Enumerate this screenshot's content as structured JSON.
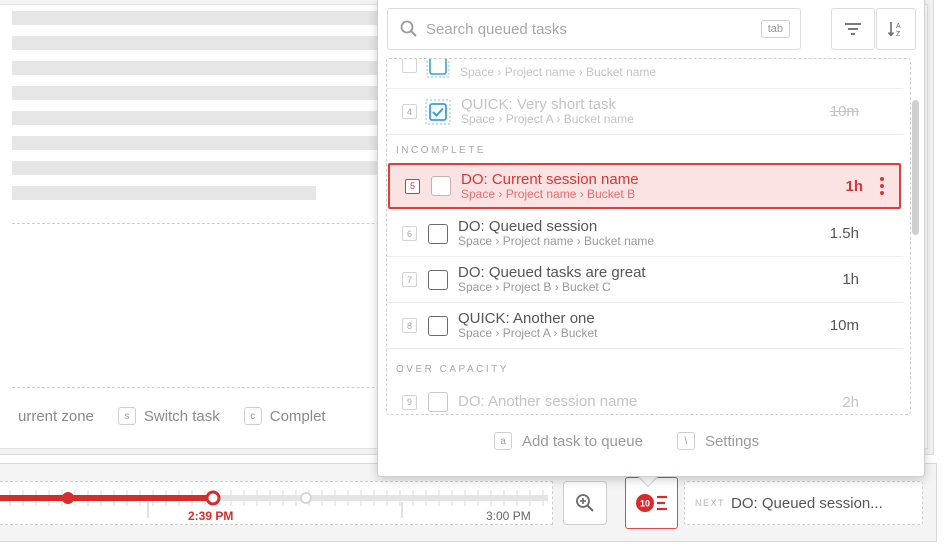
{
  "popup": {
    "search_placeholder": "Search queued tasks",
    "search_key": "tab",
    "sections": {
      "incomplete": "INCOMPLETE",
      "over_capacity": "OVER CAPACITY"
    },
    "tasks": [
      {
        "num": "",
        "title": "",
        "sub": "Space › Project name › Bucket name",
        "dur": "???",
        "state": "faded-checked"
      },
      {
        "num": "4",
        "title": "QUICK: Very short task",
        "sub": "Space › Project A › Bucket name",
        "dur": "10m",
        "state": "faded-checked"
      },
      {
        "num": "5",
        "title": "DO: Current session name",
        "sub": "Space › Project name › Bucket B",
        "dur": "1h",
        "state": "current"
      },
      {
        "num": "6",
        "title": "DO: Queued session",
        "sub": "Space › Project name › Bucket name",
        "dur": "1.5h",
        "state": "normal"
      },
      {
        "num": "7",
        "title": "DO: Queued tasks are great",
        "sub": "Space › Project B › Bucket C",
        "dur": "1h",
        "state": "normal"
      },
      {
        "num": "8",
        "title": "QUICK: Another one",
        "sub": "Space › Project A › Bucket",
        "dur": "10m",
        "state": "normal"
      },
      {
        "num": "9",
        "title": "DO: Another session name",
        "sub": "",
        "dur": "2h",
        "state": "faded"
      }
    ],
    "footer": {
      "add_key": "a",
      "add_label": "Add task to queue",
      "settings_key": "\\",
      "settings_label": "Settings"
    }
  },
  "shortcuts": [
    {
      "key": "",
      "label": "urrent zone"
    },
    {
      "key": "s",
      "label": "Switch task"
    },
    {
      "key": "c",
      "label": "Complet"
    }
  ],
  "timeline": {
    "current_time": "2:39 PM",
    "end_time": "3:00 PM",
    "progress": 0.38
  },
  "queue_button": {
    "count": "10"
  },
  "next": {
    "label": "NEXT",
    "text": "DO: Queued session..."
  },
  "colors": {
    "accent": "#e13d3d",
    "current_bg": "#fbe3e4",
    "checked": "#3aa0d8"
  }
}
